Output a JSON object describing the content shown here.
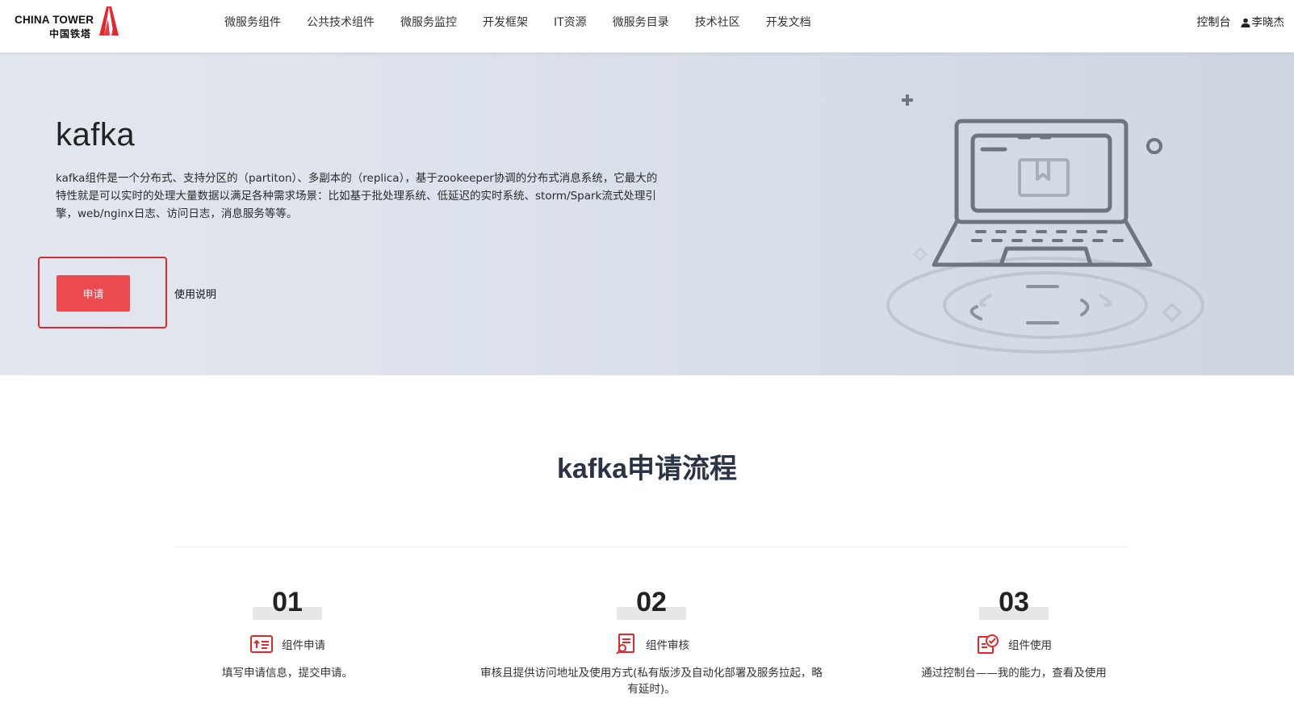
{
  "brand": {
    "logo_en": "CHINA TOWER",
    "logo_cn": "中国铁塔",
    "accent_color": "#e6262b"
  },
  "nav": {
    "items": [
      {
        "label": "微服务组件"
      },
      {
        "label": "公共技术组件"
      },
      {
        "label": "微服务监控"
      },
      {
        "label": "开发框架"
      },
      {
        "label": "IT资源"
      },
      {
        "label": "微服务目录"
      },
      {
        "label": "技术社区"
      },
      {
        "label": "开发文档"
      }
    ],
    "console_label": "控制台",
    "user_name": "李晓杰",
    "user_icon": "user-icon"
  },
  "hero": {
    "title": "kafka",
    "description": "kafka组件是一个分布式、支持分区的（partiton）、多副本的（replica），基于zookeeper协调的分布式消息系统，它最大的特性就是可以实时的处理大量数据以满足各种需求场景：比如基于批处理系统、低延迟的实时系统、storm/Spark流式处理引擎，web/nginx日志、访问日志，消息服务等等。",
    "apply_label": "申请",
    "usage_label": "使用说明",
    "illustration_icon": "laptop-illustration"
  },
  "process": {
    "title": "kafka申请流程",
    "steps": [
      {
        "number": "01",
        "label": "组件申请",
        "icon": "apply-form-icon",
        "desc": "填写申请信息，提交申请。"
      },
      {
        "number": "02",
        "label": "组件审核",
        "icon": "review-document-icon",
        "desc": "审核且提供访问地址及使用方式(私有版涉及自动化部署及服务拉起，略有延时)。"
      },
      {
        "number": "03",
        "label": "组件使用",
        "icon": "usage-check-icon",
        "desc": "通过控制台——我的能力，查看及使用"
      }
    ]
  }
}
